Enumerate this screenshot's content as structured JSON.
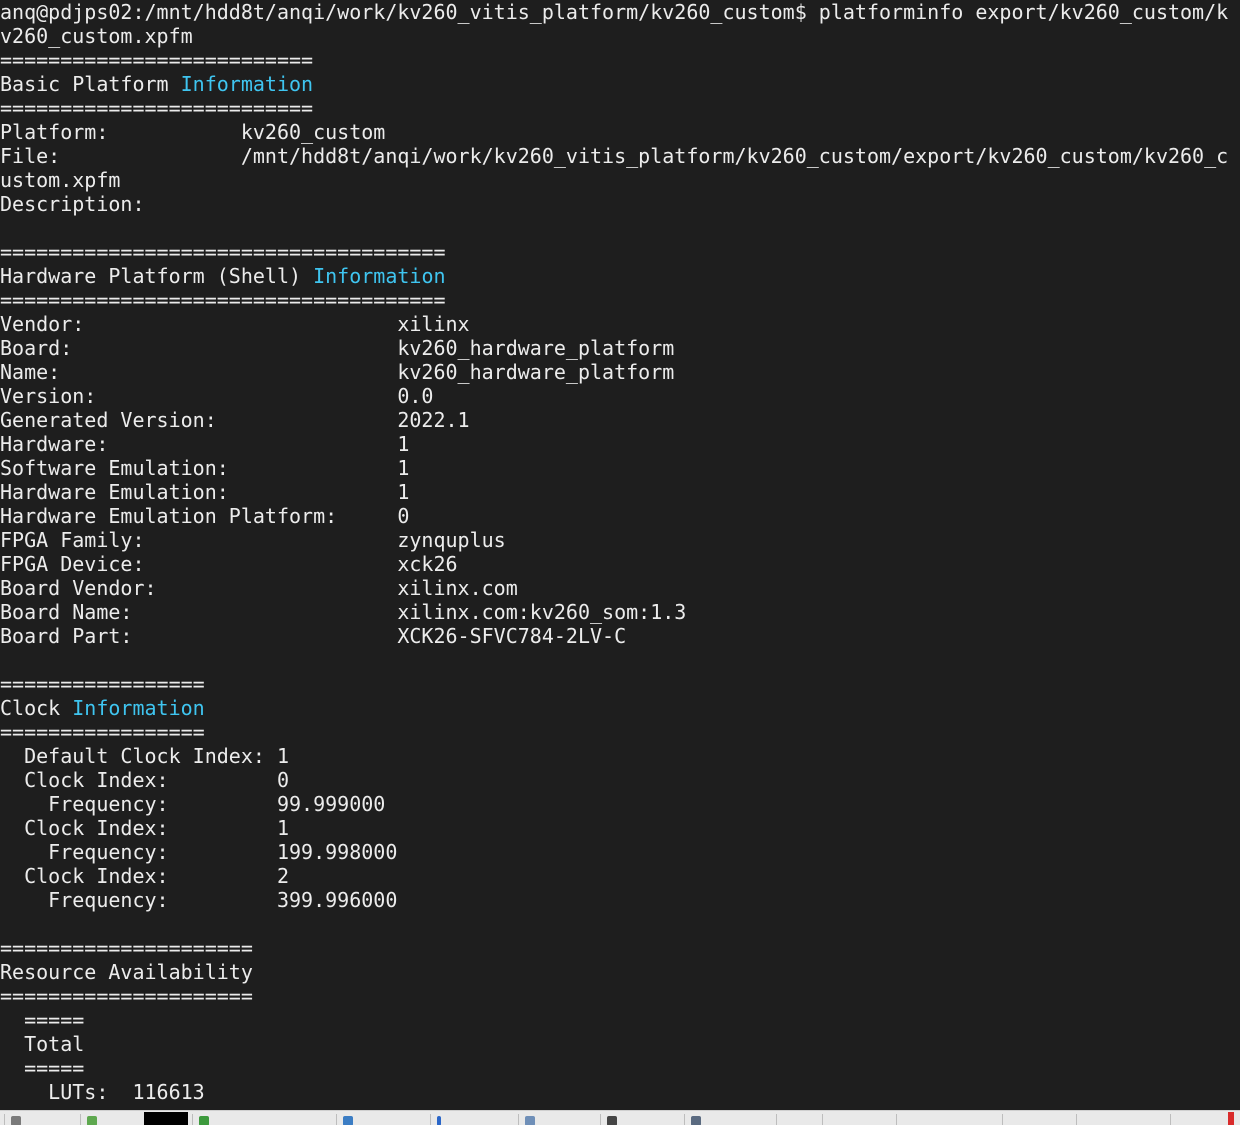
{
  "terminal": {
    "lines": [
      "anq@pdjps02:/mnt/hdd8t/anqi/work/kv260_vitis_platform/kv260_custom$ platforminfo export/kv260_custom/k",
      "v260_custom.xpfm",
      "==========================",
      [
        "Basic Platform ",
        "Information"
      ],
      "==========================",
      "Platform:           kv260_custom",
      "File:               /mnt/hdd8t/anqi/work/kv260_vitis_platform/kv260_custom/export/kv260_custom/kv260_c",
      "ustom.xpfm",
      "Description:",
      "",
      "=====================================",
      [
        "Hardware Platform (Shell) ",
        "Information"
      ],
      "=====================================",
      "Vendor:                          xilinx",
      "Board:                           kv260_hardware_platform",
      "Name:                            kv260_hardware_platform",
      "Version:                         0.0",
      "Generated Version:               2022.1",
      "Hardware:                        1",
      "Software Emulation:              1",
      "Hardware Emulation:              1",
      "Hardware Emulation Platform:     0",
      "FPGA Family:                     zynquplus",
      "FPGA Device:                     xck26",
      "Board Vendor:                    xilinx.com",
      "Board Name:                      xilinx.com:kv260_som:1.3",
      "Board Part:                      XCK26-SFVC784-2LV-C",
      "",
      "=================",
      [
        "Clock ",
        "Information"
      ],
      "=================",
      "  Default Clock Index: 1",
      "  Clock Index:         0",
      "    Frequency:         99.999000",
      "  Clock Index:         1",
      "    Frequency:         199.998000",
      "  Clock Index:         2",
      "    Frequency:         399.996000",
      "",
      "=====================",
      "Resource Availability",
      "=====================",
      "  =====",
      "  Total",
      "  =====",
      "    LUTs:  116613"
    ]
  },
  "colors": {
    "background": "#1e1e1e",
    "text": "#ececec",
    "highlight": "#3fc5f0"
  },
  "taskbar": {
    "icons": [
      "window-icon",
      "app-icon",
      "terminal-icon",
      "file-manager-icon",
      "editor-icon",
      "download-icon",
      "document-icon",
      "console-icon",
      "device-icon"
    ]
  }
}
